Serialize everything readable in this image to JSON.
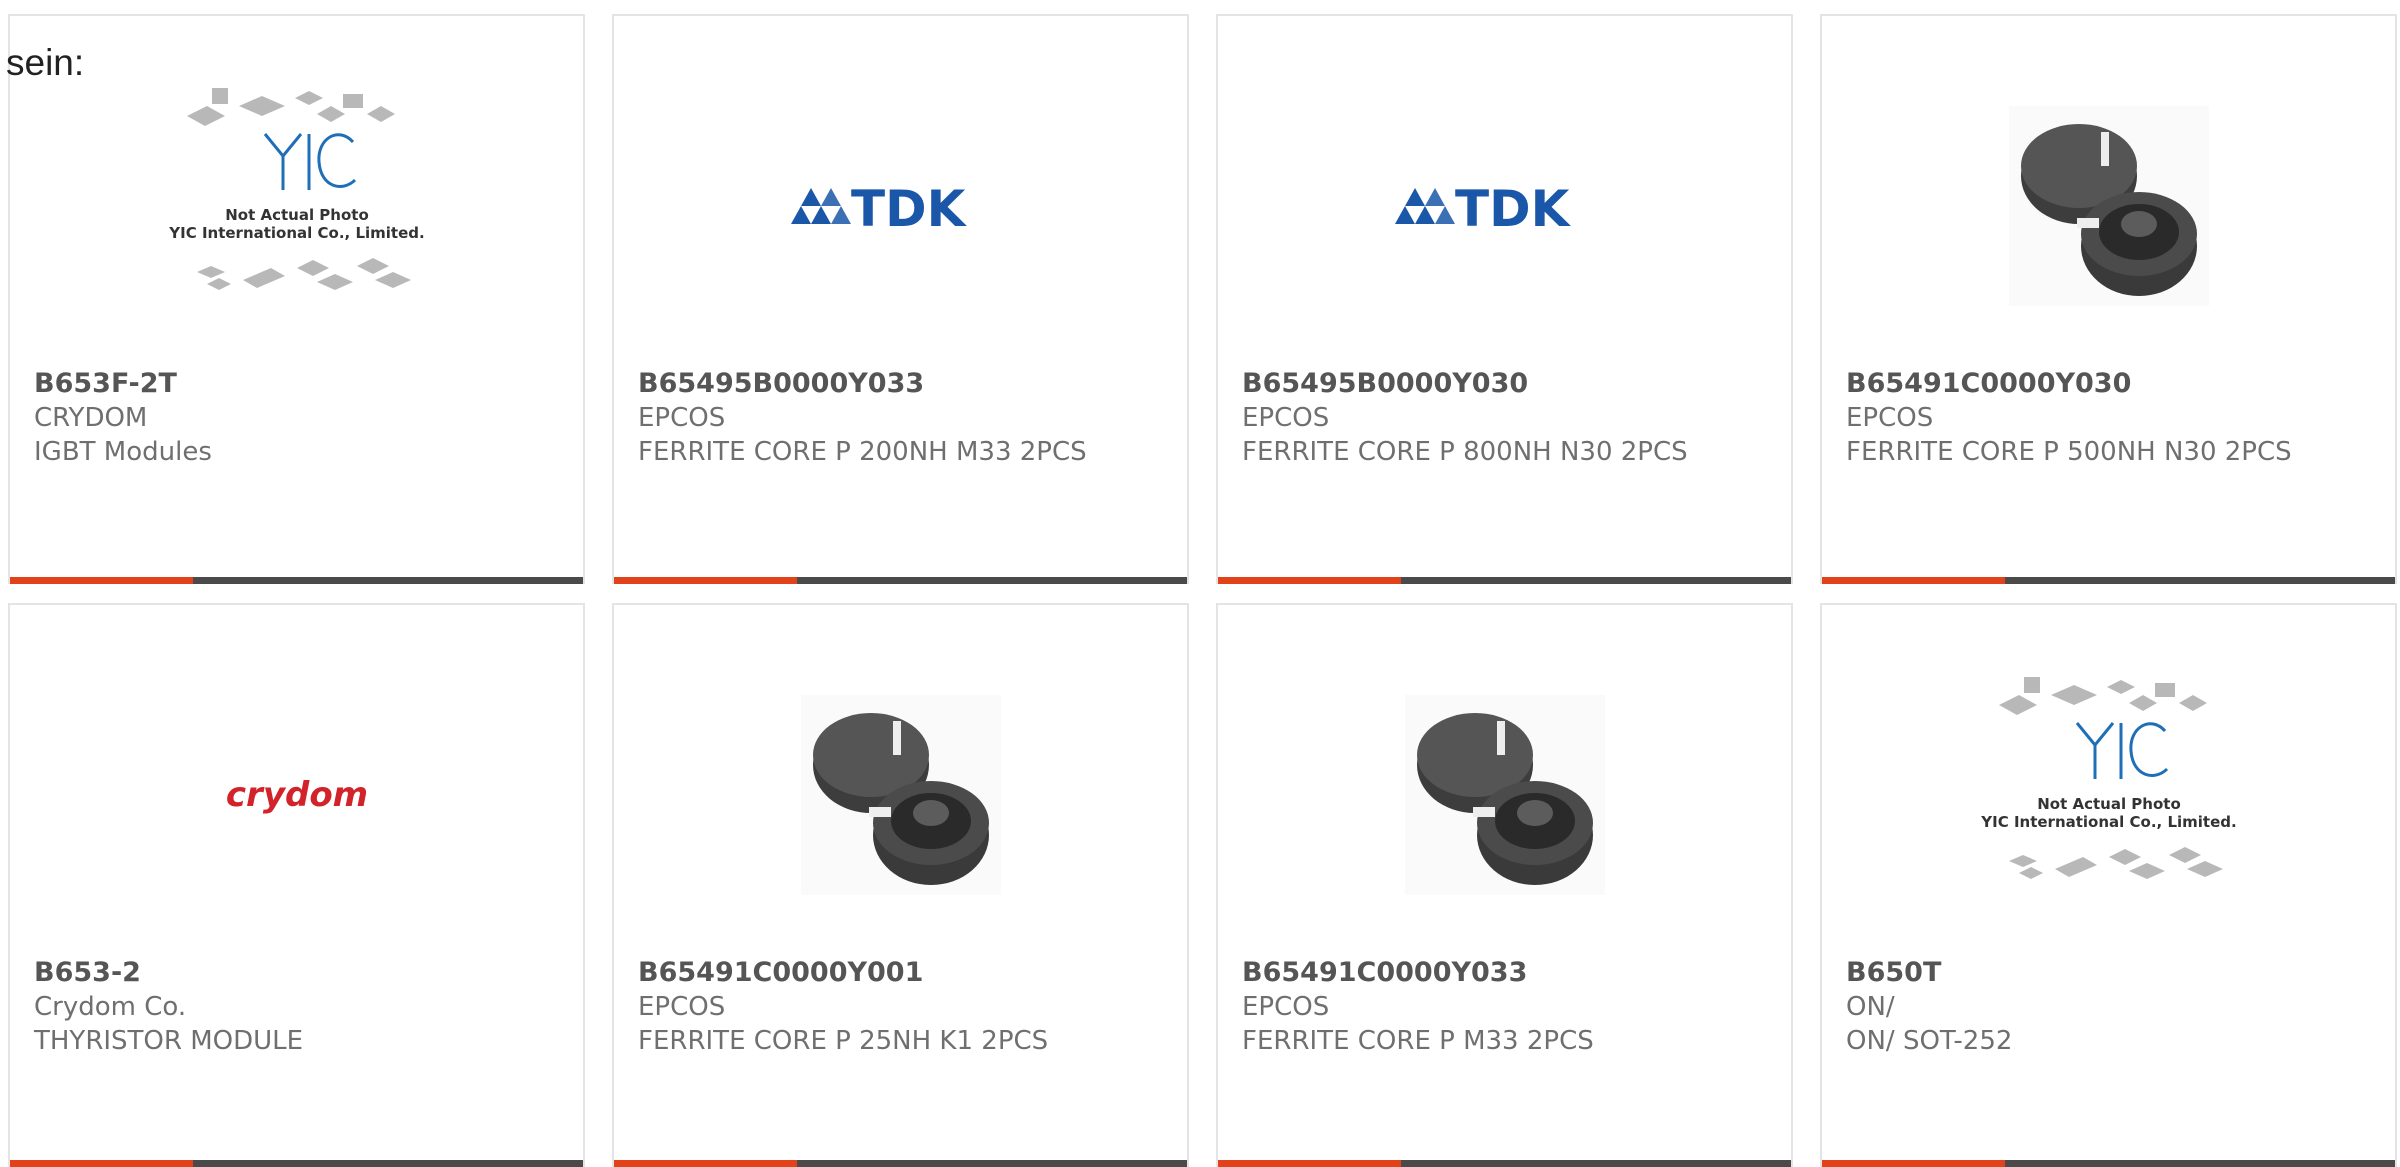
{
  "intro_text": "sein:",
  "placeholder": {
    "caption_line1": "Not Actual Photo",
    "caption_line2": "YIC International Co., Limited."
  },
  "brands": {
    "tdk": "TDK",
    "crydom": "crydom"
  },
  "colors": {
    "accent": "#e2421a",
    "bar": "#4a4a4a",
    "tdk_blue": "#1a57a8",
    "crydom_red": "#d2232a"
  },
  "products": [
    {
      "part": "B653F-2T",
      "maker": "CRYDOM",
      "desc": "IGBT Modules",
      "image": "placeholder-yic"
    },
    {
      "part": "B65495B0000Y033",
      "maker": "EPCOS",
      "desc": "FERRITE CORE P 200NH M33 2PCS",
      "image": "tdk-logo"
    },
    {
      "part": "B65495B0000Y030",
      "maker": "EPCOS",
      "desc": "FERRITE CORE P 800NH N30 2PCS",
      "image": "tdk-logo"
    },
    {
      "part": "B65491C0000Y030",
      "maker": "EPCOS",
      "desc": "FERRITE CORE P 500NH N30 2PCS",
      "image": "ferrite-core"
    },
    {
      "part": "B653-2",
      "maker": "Crydom Co.",
      "desc": "THYRISTOR MODULE",
      "image": "crydom-logo"
    },
    {
      "part": "B65491C0000Y001",
      "maker": "EPCOS",
      "desc": "FERRITE CORE P 25NH K1 2PCS",
      "image": "ferrite-core"
    },
    {
      "part": "B65491C0000Y033",
      "maker": "EPCOS",
      "desc": "FERRITE CORE P M33 2PCS",
      "image": "ferrite-core"
    },
    {
      "part": "B650T",
      "maker": "ON/",
      "desc": "ON/ SOT-252",
      "image": "placeholder-yic"
    }
  ]
}
